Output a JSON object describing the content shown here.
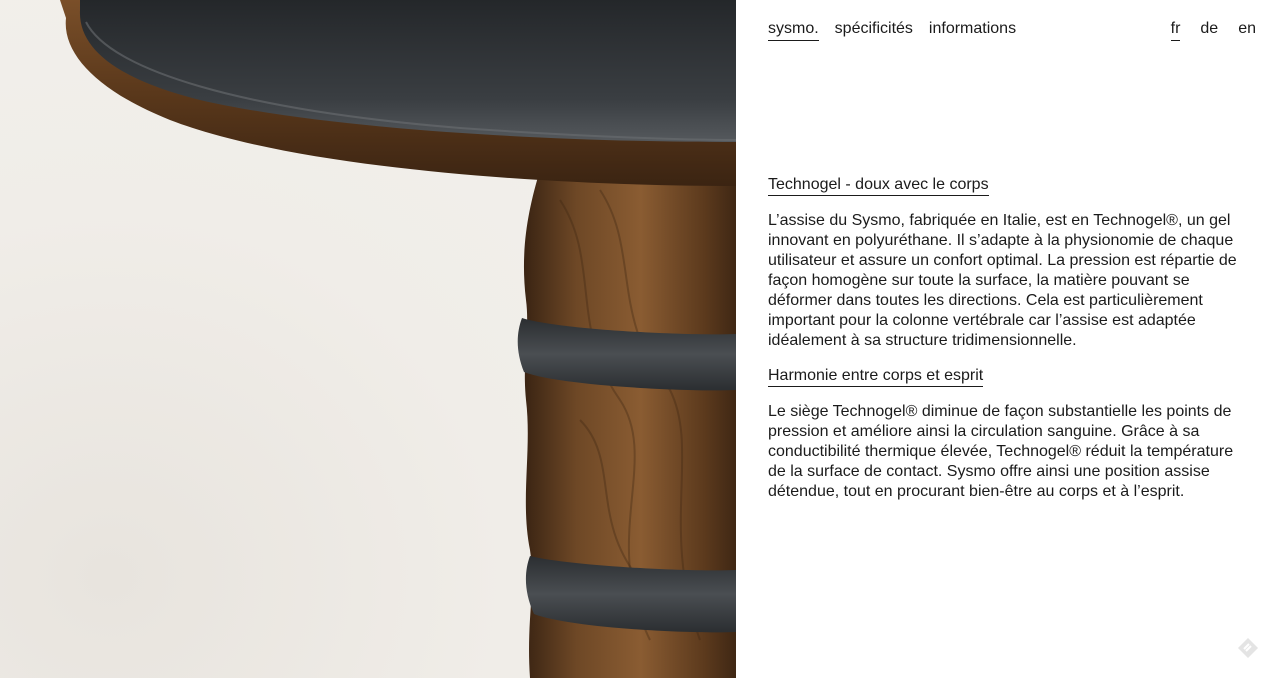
{
  "nav": {
    "items": [
      {
        "label": "sysmo.",
        "active": true
      },
      {
        "label": "spécificités",
        "active": false
      },
      {
        "label": "informations",
        "active": false
      }
    ]
  },
  "languages": {
    "items": [
      {
        "label": "fr",
        "active": true
      },
      {
        "label": "de",
        "active": false
      },
      {
        "label": "en",
        "active": false
      }
    ]
  },
  "content": {
    "sections": [
      {
        "heading": "Technogel - doux avec le corps",
        "text": "L’assise du Sysmo, fabriquée en Italie, est en Technogel®, un gel innovant en polyuréthane. Il s’adapte à la physionomie de chaque utilisateur et assure un confort optimal. La pression est répartie de façon homogène sur toute la surface, la matière pouvant se déformer dans toutes les directions. Cela est particulièrement important pour la colonne vertébrale car l’assise est adaptée idéalement à sa structure tridimensionnelle."
      },
      {
        "heading": "Harmonie entre corps et esprit",
        "text": "Le siège Technogel® diminue de façon substantielle les points de pression et améliore ainsi la circulation sanguine. Grâce à sa conductibilité thermique élevée, Technogel® réduit la température de la surface de contact. Sysmo offre ainsi une position assise détendue, tout en procurant bien-être au corps et à l’esprit."
      }
    ]
  },
  "image": {
    "subject": "walnut stool with black Technogel seat",
    "icon": "wooden-stool-photo"
  },
  "corner_badge": {
    "icon": "diamond-badge-icon"
  },
  "colors": {
    "text": "#1b1b1b",
    "background": "#ffffff",
    "wood": "#5b3a1e",
    "seat": "#2f3236"
  }
}
